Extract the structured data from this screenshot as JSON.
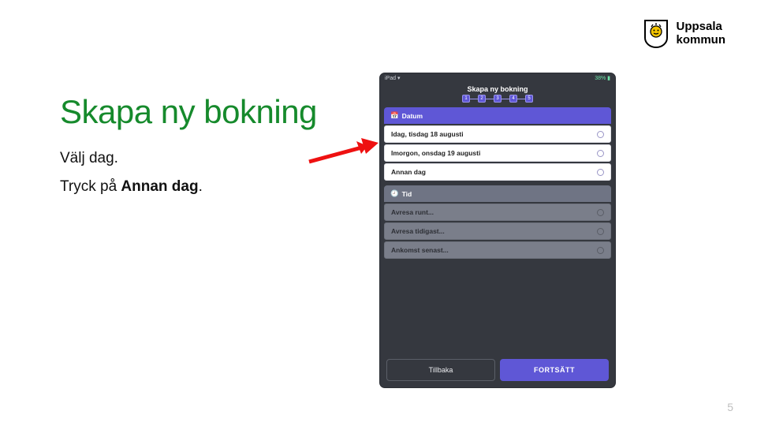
{
  "logo": {
    "line1": "Uppsala",
    "line2": "kommun"
  },
  "heading": "Skapa ny bokning",
  "body": {
    "line1": "Välj dag.",
    "line2_prefix": "Tryck på ",
    "line2_bold": "Annan dag",
    "line2_suffix": "."
  },
  "phone": {
    "status_left": "iPad ▾",
    "status_right": "38% ▮",
    "title": "Skapa ny bokning",
    "steps": [
      "1",
      "2",
      "3",
      "4",
      "5"
    ],
    "section_date": {
      "icon": "📅",
      "label": "Datum"
    },
    "date_options": [
      "Idag, tisdag 18 augusti",
      "Imorgon, onsdag 19 augusti",
      "Annan dag"
    ],
    "section_time": {
      "icon": "🕘",
      "label": "Tid"
    },
    "time_options": [
      "Avresa runt...",
      "Avresa tidigast...",
      "Ankomst senast..."
    ],
    "btn_back": "Tillbaka",
    "btn_next": "FORTSÄTT"
  },
  "page_number": "5"
}
